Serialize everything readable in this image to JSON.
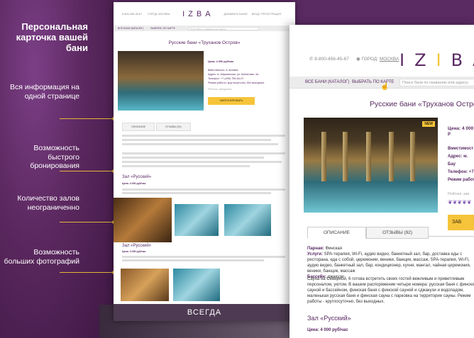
{
  "promo": {
    "title": "Персональная карточка вашей бани",
    "features": [
      "Вся информация на одной странице",
      "Возможность быстрого бронирования",
      "Количество залов неограниченно",
      "Возможность больших фотографий"
    ],
    "accent": "#e3b53a",
    "bg": "#5b285f"
  },
  "mini_page": {
    "phone": "8-800-456-45-67",
    "city": "ГОРОД: МОСКВА",
    "logo": "IZBA",
    "links": [
      "ДОБАВИТЬ БАНЮ",
      "ВХОД / РЕГИСТРАЦИЯ"
    ],
    "nav": [
      "ВСЕ БАНИ (КАТАЛОГ)",
      "ВЫБРАТЬ ПО КАРТЕ"
    ],
    "search_placeholder": "Поиск бани по названию или адресу",
    "title": "Русские бани «Труханов Остров»",
    "price": "Цена: 4 000 руб/час",
    "info": [
      "Вместимость: 6 человек",
      "Адрес: м. Бауманская, ул. Шаталова, 4а",
      "Телефон: +7 (499) 756-64-07",
      "Режим работы: круглосуточно, без выходных"
    ],
    "rating_label": "Рейтинг заведения",
    "book": "ЗАБРОНИРОВАТЬ",
    "tabs": [
      "ОПИСАНИЕ",
      "ОТЗЫВЫ (92)"
    ],
    "hall1": "Зал «Русский»",
    "hall1_price": "Цена: 4 000 руб/час",
    "hall2": "Зал «Русский»",
    "hall2_price": "Цена: 4 000 руб/час",
    "footer": "ВСЕГДА"
  },
  "big_page": {
    "phone": "8-800-456-45-67",
    "city_label": "ГОРОД:",
    "city": "МОСКВА",
    "logo_left": "IZ",
    "logo_mid": "I",
    "logo_right": "BA",
    "nav_catalog": "ВСЕ БАНИ (КАТАЛОГ)",
    "nav_map": "ВЫБРАТЬ ПО КАРТЕ",
    "search_placeholder": "Поиск бани по названию или адресу",
    "title": "Русские бани «Труханов Остров»",
    "badge": "NEW",
    "price": "Цена: 4 000 р",
    "info": [
      "Вместимост",
      "Адрес: м. Бау",
      "Телефон: +7",
      "Режим работ"
    ],
    "rating": "Рейтинг зав",
    "book": "ЗАБ",
    "tab_desc": "ОПИСАНИЕ",
    "tab_reviews": "ОТЗЫВЫ (92)",
    "details_parnaya_label": "Парная:",
    "details_parnaya": " Финская",
    "details_services_label": "Услуги:",
    "details_services": " SPA-терапия, Wi-Fi, аудио видео, банкетный зал, бар, доставка еды с ресторана, еда с собой, церемонии, веники, банщик, массаж, SPA-терапия, Wi-Fi, аудио видео, банкетный зал, бар, кондиционер, кухня, мангал, чайная церемония, веники, банщик, массаж",
    "details_pool_label": "Бассейн:",
    "details_pool": " джакузи",
    "about": "Сауна на Северной, 6 готова встретить своих гостей вежливым и приветливым персоналом, уютом. В вашем распоряжении четыре номера: русская баня с финской сауной и бассейном, финская баня с финской сауной и сджакузи и водопадом, маленькая русская баня и финская сауна с парковка на территории сауны. Режим работы - круглосуточно, без выходных.",
    "hall": "Зал «Русский»",
    "hall_price": "Цена: 4 000 руб/час"
  }
}
